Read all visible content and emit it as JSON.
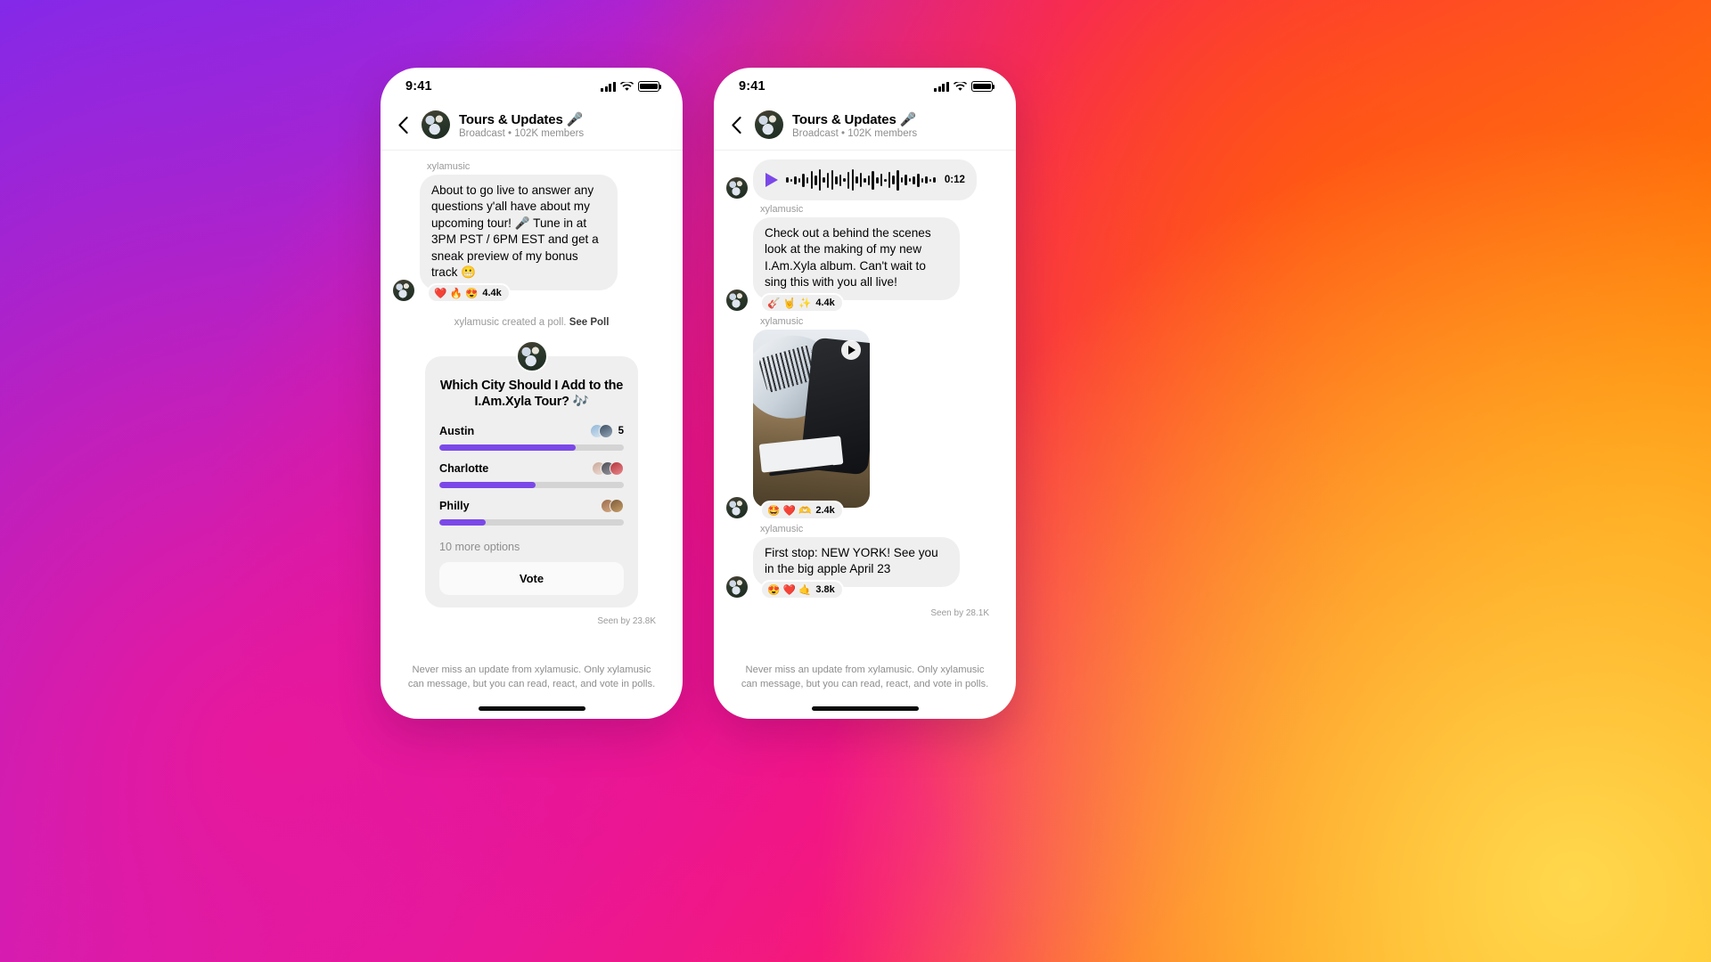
{
  "theme": {
    "accent_purple": "#7B48E8",
    "bubble_gray": "#EFEFEF",
    "muted_text": "#8E8E8E"
  },
  "status_bar": {
    "time": "9:41"
  },
  "header": {
    "title": "Tours & Updates 🎤",
    "subtitle": "Broadcast • 102K members",
    "back_icon": "chevron-left-icon"
  },
  "footer_note": "Never miss an update from xylamusic. Only xylamusic can message, but you can read, react, and vote in polls.",
  "phone_left": {
    "sender": "xylamusic",
    "message": "About to go live to answer any questions y'all have about my upcoming tour! 🎤 Tune in at 3PM PST / 6PM EST and get a sneak preview of my bonus track 😬",
    "reaction": {
      "emojis": "❤️ 🔥 😍",
      "count": "4.4k"
    },
    "system_note_text": "xylamusic created a poll.",
    "system_note_link": "See Poll",
    "poll": {
      "question": "Which City Should I Add to the I.Am.Xyla Tour? 🎶",
      "options": [
        {
          "label": "Austin",
          "percent": 74,
          "voters": 2,
          "count": "5"
        },
        {
          "label": "Charlotte",
          "percent": 52,
          "voters": 3,
          "count": ""
        },
        {
          "label": "Philly",
          "percent": 25,
          "voters": 2,
          "count": ""
        }
      ],
      "more_options": "10 more options",
      "vote_button": "Vote"
    },
    "seen_by": "Seen by 23.8K"
  },
  "phone_right": {
    "voice_note": {
      "duration": "0:12",
      "play_icon": "play-icon"
    },
    "message_sender_1": "xylamusic",
    "message_1": "Check out a behind the scenes look at the making of my new I.Am.Xyla album. Can't wait to sing this with you all live!",
    "reaction_1": {
      "emojis": "🎸 🤘 ✨",
      "count": "4.4k"
    },
    "message_sender_2": "xylamusic",
    "media_play_icon": "play-icon",
    "reaction_2": {
      "emojis": "🤩 ❤️ 🫶",
      "count": "2.4k"
    },
    "message_sender_3": "xylamusic",
    "message_3": "First stop: NEW YORK! See you in the big apple April 23",
    "reaction_3": {
      "emojis": "😍 ❤️ 🤙",
      "count": "3.8k"
    },
    "seen_by": "Seen by 28.1K"
  }
}
